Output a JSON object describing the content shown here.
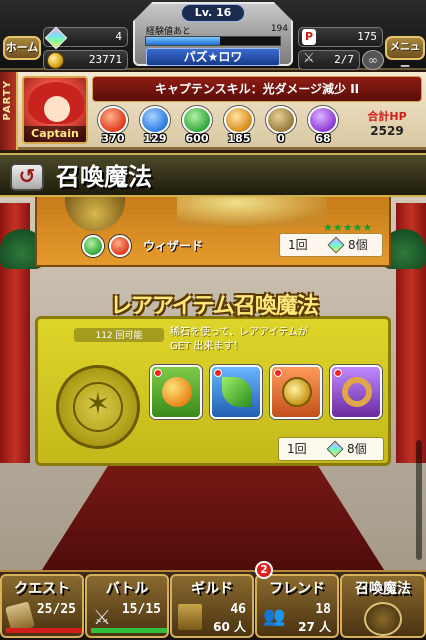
{
  "topbar": {
    "home_label": "ホーム",
    "menu_label": "メニュー",
    "gems": "4",
    "coins": "23771",
    "level": "Lv. 16",
    "exp_label": "経験値あと",
    "exp_remaining": "194",
    "exp_progress_percent": 55,
    "player_name": "パズ★ロワ",
    "stamina": "175",
    "friends": "2/7"
  },
  "party": {
    "tab_label": "PARTY",
    "captain_label": "Captain",
    "captain_skill": "キャプテンスキル：光ダメージ減少 II",
    "stats": [
      {
        "icon": "fire-orb-icon",
        "value": "370",
        "color": "#e03a1e"
      },
      {
        "icon": "water-orb-icon",
        "value": "129",
        "color": "#2a7be0"
      },
      {
        "icon": "wood-orb-icon",
        "value": "600",
        "color": "#2fa83a"
      },
      {
        "icon": "light-orb-icon",
        "value": "185",
        "color": "#d68a1a"
      },
      {
        "icon": "dark-orb-icon",
        "value": "0",
        "color": "#9a7a3a"
      },
      {
        "icon": "heart-orb-icon",
        "value": "68",
        "color": "#8a3ad6"
      }
    ],
    "hp_label": "合計HP",
    "hp_value": "2529"
  },
  "title": {
    "back_glyph": "↺",
    "text": "召喚魔法"
  },
  "card1": {
    "rarity_stars": "★★★★★",
    "type_label": "ウィザード",
    "cost_count": "1回",
    "cost_value": "8個"
  },
  "rare": {
    "header": "レアアイテム召喚魔法",
    "available": "112 回可能",
    "description_line1": "稀石を使って、レアアイテムが",
    "description_line2": "GET 出来ます！",
    "items": [
      {
        "icon": "apple-icon",
        "bg": "#4a9a2a"
      },
      {
        "icon": "leaf-icon",
        "bg": "#2a6ab0"
      },
      {
        "icon": "medal-icon",
        "bg": "#c8541a"
      },
      {
        "icon": "ring-icon",
        "bg": "#7a2aa0"
      }
    ],
    "cost_count": "1回",
    "cost_value": "8個"
  },
  "nav": {
    "quest": {
      "label": "クエスト",
      "value": "25/25",
      "progress_percent": 100
    },
    "battle": {
      "label": "バトル",
      "value": "15/15",
      "progress_percent": 100
    },
    "guild": {
      "label": "ギルド",
      "value1": "46",
      "value2": "60 人",
      "badge": "2"
    },
    "friend": {
      "label": "フレンド",
      "value1": "18",
      "value2": "27 人"
    },
    "summon": {
      "label": "召喚魔法"
    }
  }
}
